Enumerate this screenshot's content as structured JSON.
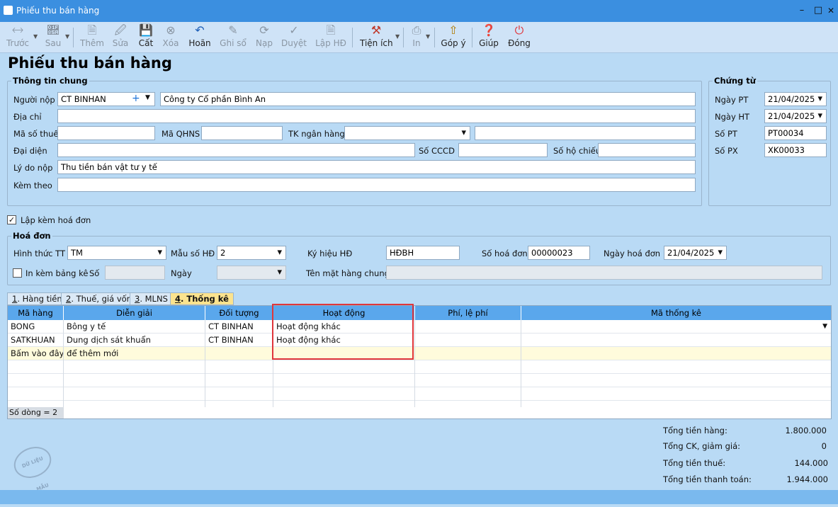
{
  "window": {
    "title": "Phiếu thu bán hàng"
  },
  "toolbar": {
    "items": [
      {
        "label": "Trước",
        "icon": "arrow-left-icon"
      },
      {
        "label": "Sau",
        "icon": "arrow-right-icon"
      },
      {
        "label": "Thêm",
        "icon": "new-document-icon"
      },
      {
        "label": "Sửa",
        "icon": "edit-document-icon"
      },
      {
        "label": "Cất",
        "icon": "save-icon"
      },
      {
        "label": "Xóa",
        "icon": "delete-icon"
      },
      {
        "label": "Hoãn",
        "icon": "undo-icon"
      },
      {
        "label": "Ghi sổ",
        "icon": "pencil-icon"
      },
      {
        "label": "Nạp",
        "icon": "reload-icon"
      },
      {
        "label": "Duyệt",
        "icon": "check-icon"
      },
      {
        "label": "Lập HĐ",
        "icon": "invoice-icon"
      },
      {
        "label": "Tiện ích",
        "icon": "tools-icon"
      },
      {
        "label": "In",
        "icon": "printer-icon"
      },
      {
        "label": "Góp ý",
        "icon": "feedback-icon"
      },
      {
        "label": "Giúp",
        "icon": "help-icon"
      },
      {
        "label": "Đóng",
        "icon": "power-icon"
      }
    ]
  },
  "page": {
    "heading": "Phiếu thu bán hàng"
  },
  "general": {
    "title": "Thông tin chung",
    "payer_label": "Người nộp",
    "payer_code": "CT BINHAN",
    "payer_name": "Công ty Cổ phần Bình An",
    "address_label": "Địa chỉ",
    "address": "",
    "tax_label": "Mã số thuế",
    "tax": "",
    "qhns_label": "Mã QHNS",
    "qhns": "",
    "bank_label": "TK ngân hàng",
    "bank": "",
    "bank_name": "",
    "rep_label": "Đại diện",
    "rep": "",
    "cccd_label": "Số CCCD",
    "cccd": "",
    "passport_label": "Số hộ chiếu",
    "passport": "",
    "reason_label": "Lý do nộp",
    "reason": "Thu tiền bán vật tư y tế",
    "attach_label": "Kèm theo",
    "attach": ""
  },
  "voucher": {
    "title": "Chứng từ",
    "date_pt_label": "Ngày PT",
    "date_pt": "21/04/2025",
    "date_ht_label": "Ngày HT",
    "date_ht": "21/04/2025",
    "so_pt_label": "Số PT",
    "so_pt": "PT00034",
    "so_px_label": "Số PX",
    "so_px": "XK00033"
  },
  "with_invoice": {
    "label": "Lập kèm hoá đơn",
    "checked": true
  },
  "invoice": {
    "title": "Hoá đơn",
    "method_label": "Hình thức TT",
    "method": "TM",
    "template_label": "Mẫu số HĐ",
    "template": "2",
    "symbol_label": "Ký hiệu HĐ",
    "symbol": "HĐBH",
    "number_label": "Số hoá đơn",
    "number": "00000023",
    "date_label": "Ngày hoá đơn",
    "date": "21/04/2025",
    "print_list_label": "In kèm bảng kê",
    "print_list_checked": false,
    "so_label": "Số",
    "so": "",
    "ngay_label": "Ngày",
    "ngay": "",
    "goods_label": "Tên mặt hàng chung",
    "goods": ""
  },
  "tabs": [
    {
      "key": "1",
      "label": ". Hàng tiền"
    },
    {
      "key": "2",
      "label": ". Thuế, giá vốn"
    },
    {
      "key": "3",
      "label": ". MLNS"
    },
    {
      "key": "4",
      "label": ". Thống kê"
    }
  ],
  "grid": {
    "columns": [
      "Mã hàng",
      "Diễn giải",
      "Đối tượng",
      "Hoạt động",
      "Phí, lệ phí",
      "Mã thống kê"
    ],
    "rows": [
      [
        "BONG",
        "Bông y tế",
        "CT BINHAN",
        "Hoạt động khác",
        "",
        ""
      ],
      [
        "SATKHUAN",
        "Dung dịch sát khuẩn",
        "CT BINHAN",
        "Hoạt động khác",
        "",
        ""
      ]
    ],
    "add_row_hint": "Bấm vào đây để thêm mới",
    "row_count": "Số dòng = 2"
  },
  "totals": {
    "goods_label": "Tổng tiền hàng:",
    "goods": "1.800.000",
    "discount_label": "Tổng CK, giảm giá:",
    "discount": "0",
    "tax_label": "Tổng tiền thuế:",
    "tax": "144.000",
    "pay_label": "Tổng tiền thanh toán:",
    "pay": "1.944.000"
  },
  "stamp": {
    "text": "DỮ LIỆU MẪU"
  },
  "colors": {
    "titlebar": "#3b8fe0",
    "background": "#b9daf5",
    "grid_header": "#5aa7ec",
    "highlight": "#e0363b",
    "active_tab": "#fbe38e",
    "new_row": "#fffbdc"
  }
}
